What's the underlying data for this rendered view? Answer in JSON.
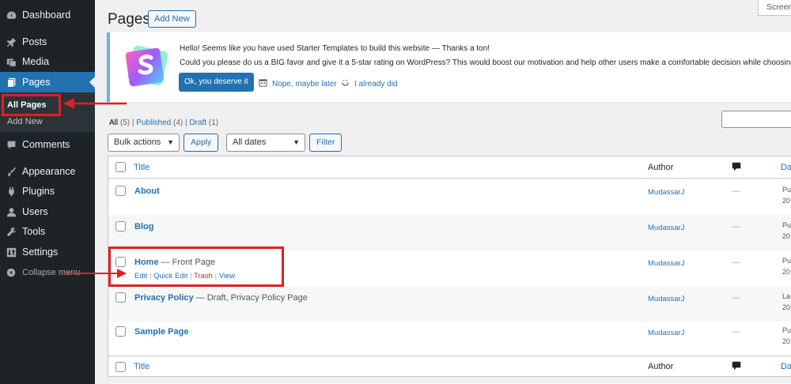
{
  "sidebar": {
    "items": [
      {
        "label": "Dashboard",
        "icon": "dashboard-icon"
      },
      {
        "label": "Posts",
        "icon": "pin-icon"
      },
      {
        "label": "Media",
        "icon": "media-icon"
      },
      {
        "label": "Pages",
        "icon": "pages-icon"
      },
      {
        "label": "Comments",
        "icon": "comment-icon"
      },
      {
        "label": "Appearance",
        "icon": "brush-icon"
      },
      {
        "label": "Plugins",
        "icon": "plugin-icon"
      },
      {
        "label": "Users",
        "icon": "user-icon"
      },
      {
        "label": "Tools",
        "icon": "wrench-icon"
      },
      {
        "label": "Settings",
        "icon": "settings-icon"
      }
    ],
    "submenu": {
      "all_pages": "All Pages",
      "add_new": "Add New"
    },
    "collapse": "Collapse menu"
  },
  "header": {
    "title": "Pages",
    "add_new": "Add New",
    "screen_options": "Screen"
  },
  "notice": {
    "line1": "Hello! Seems like you have used Starter Templates to build this website — Thanks a ton!",
    "line2": "Could you please do us a BIG favor and give it a 5-star rating on WordPress? This would boost our motivation and help other users make a comfortable decision while choosing the S",
    "primary": "Ok, you deserve it",
    "later": "Nope, maybe later",
    "done": "I already did"
  },
  "filters": {
    "all": "All",
    "all_count": "(5)",
    "published": "Published",
    "published_count": "(4)",
    "draft": "Draft",
    "draft_count": "(1)",
    "sep": "|"
  },
  "tablenav": {
    "bulk": "Bulk actions",
    "apply": "Apply",
    "dates": "All dates",
    "filter": "Filter"
  },
  "table": {
    "headers": {
      "title": "Title",
      "author": "Author",
      "date": "Da"
    },
    "rows": [
      {
        "title": "About",
        "state": "",
        "author": "MudassarJ",
        "comments": "—",
        "date1": "Pu",
        "date2": "20"
      },
      {
        "title": "Blog",
        "state": "",
        "author": "MudassarJ",
        "comments": "—",
        "date1": "Pu",
        "date2": "20"
      },
      {
        "title": "Home",
        "state": " — Front Page",
        "author": "MudassarJ",
        "comments": "—",
        "date1": "Pu",
        "date2": "20"
      },
      {
        "title": "Privacy Policy",
        "state": " — Draft, Privacy Policy Page",
        "author": "MudassarJ",
        "comments": "—",
        "date1": "La",
        "date2": "20"
      },
      {
        "title": "Sample Page",
        "state": "",
        "author": "MudassarJ",
        "comments": "—",
        "date1": "Pu",
        "date2": "20"
      }
    ],
    "row_actions": {
      "edit": "Edit",
      "quick_edit": "Quick Edit",
      "trash": "Trash",
      "view": "View",
      "sep": "|"
    }
  },
  "colors": {
    "sidebar": "#1d2327",
    "accent": "#2271b1",
    "annotation": "#e02020"
  }
}
